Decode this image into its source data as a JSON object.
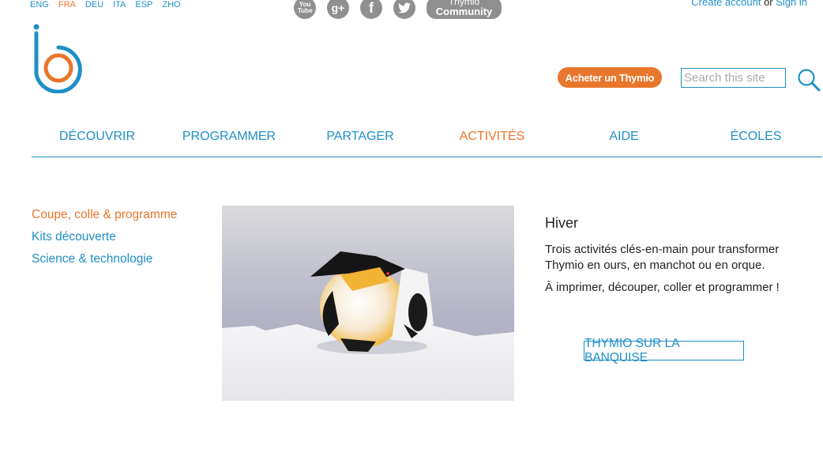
{
  "languages": [
    {
      "code": "ENG",
      "active": false
    },
    {
      "code": "FRA",
      "active": true
    },
    {
      "code": "DEU",
      "active": false
    },
    {
      "code": "ITA",
      "active": false
    },
    {
      "code": "ESP",
      "active": false
    },
    {
      "code": "ZHO",
      "active": false
    }
  ],
  "social": {
    "youtube": "You Tube",
    "gplus": "g+",
    "facebook": "f",
    "community_line1": "Thymio",
    "community_line2": "Community"
  },
  "account": {
    "create": "Create account",
    "or": "or",
    "signin": "Sign in"
  },
  "header": {
    "buy_label": "Acheter un Thymio",
    "search_placeholder": "Search this site"
  },
  "nav": {
    "items": [
      "DÉCOUVRIR",
      "PROGRAMMER",
      "PARTAGER",
      "ACTIVITÉS",
      "AIDE",
      "ÉCOLES"
    ],
    "active_index": 3
  },
  "sidebar": {
    "items": [
      "Coupe, colle & programme",
      "Kits découverte",
      "Science & technologie"
    ],
    "active_index": 0
  },
  "feature": {
    "title": "Hiver",
    "para1": "Trois activités clés-en-main pour transformer Thymio en ours, en manchot ou en orque.",
    "para2": "À imprimer, découper, coller et programmer !",
    "cta_label": "THYMIO SUR LA BANQUISE"
  },
  "colors": {
    "accent_blue": "#1f8fc7",
    "accent_orange": "#e8762b",
    "icon_gray": "#8f8f8f"
  }
}
